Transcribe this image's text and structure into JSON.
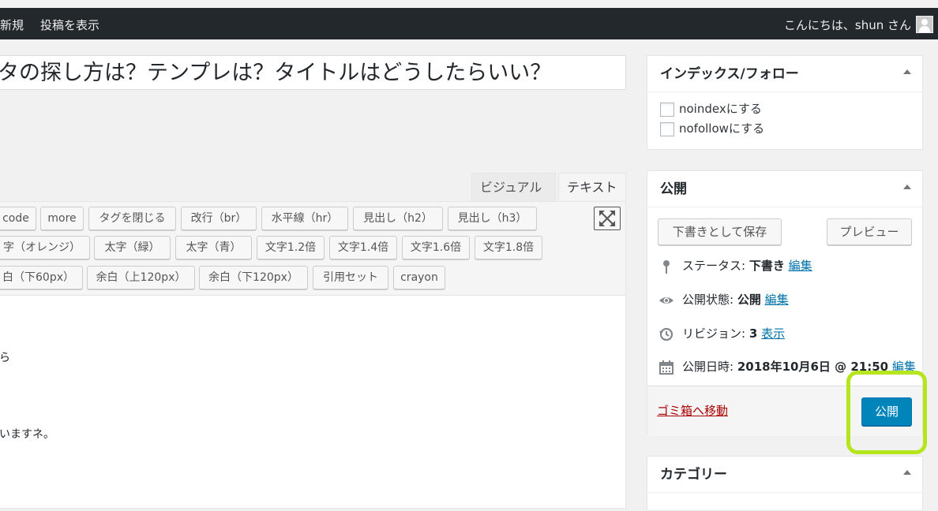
{
  "admin_bar": {
    "new_label": "新規",
    "view_post_label": "投稿を表示",
    "greeting": "こんにちは、shun さん"
  },
  "editor": {
    "title_value": "タの探し方は？テンプレは？タイトルはどうしたらいい？",
    "tabs": {
      "visual": "ビジュアル",
      "text": "テキスト"
    },
    "quicktags": {
      "row1": [
        "code",
        "more",
        "タグを閉じる",
        "改行（br）",
        "水平線（hr）",
        "見出し（h2）",
        "見出し（h3）"
      ],
      "row2": [
        "字（オレンジ）",
        "太字（緑）",
        "太字（青）",
        "文字1.2倍",
        "文字1.4倍",
        "文字1.6倍",
        "文字1.8倍"
      ],
      "row3": [
        "白（下60px）",
        "余白（上120px）",
        "余白（下120px）",
        "引用セット",
        "crayon"
      ]
    },
    "content_lines": [
      "ら",
      "いますネ。"
    ]
  },
  "index_follow_box": {
    "title": "インデックス/フォロー",
    "noindex_label": "noindexにする",
    "nofollow_label": "nofollowにする"
  },
  "publish_box": {
    "title": "公開",
    "save_draft": "下書きとして保存",
    "preview": "プレビュー",
    "status_label": "ステータス:",
    "status_value": "下書き",
    "status_edit": "編集",
    "visibility_label": "公開状態:",
    "visibility_value": "公開",
    "visibility_edit": "編集",
    "revision_label": "リビジョン:",
    "revision_value": "3",
    "revision_link": "表示",
    "schedule_label": "公開日時:",
    "schedule_value": "2018年10月6日 @ 21:50",
    "schedule_edit": "編集",
    "trash_link": "ゴミ箱へ移動",
    "publish_button": "公開"
  },
  "category_box": {
    "title": "カテゴリー"
  },
  "colors": {
    "admin_bar": "#23282d",
    "primary_button": "#0085ba",
    "link": "#0073aa",
    "trash": "#a00000",
    "highlight": "#b5e61d"
  }
}
